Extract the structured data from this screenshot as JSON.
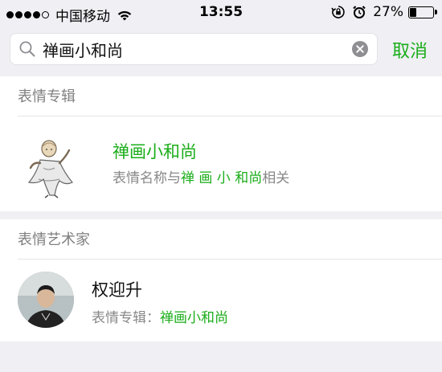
{
  "status_bar": {
    "carrier": "中国移动",
    "time": "13:55",
    "battery_percent": "27%",
    "battery_level": 0.27,
    "signal_bars": 4,
    "icons": [
      "signal-dots-icon",
      "wifi-icon",
      "orientation-lock-icon",
      "alarm-icon",
      "battery-icon"
    ]
  },
  "search": {
    "value": "禅画小和尚",
    "cancel_label": "取消"
  },
  "sticker_section": {
    "header": "表情专辑",
    "item": {
      "title": "禅画小和尚",
      "desc_prefix": "表情名称与",
      "desc_highlight": "禅 画 小 和尚",
      "desc_suffix": "相关"
    }
  },
  "artist_section": {
    "header": "表情艺术家",
    "item": {
      "name": "权迎升",
      "album_prefix": "表情专辑：",
      "album_highlight": "禅画小和尚"
    }
  },
  "colors": {
    "accent": "#1aad19",
    "background": "#efeff4",
    "secondary_text": "#888888"
  }
}
